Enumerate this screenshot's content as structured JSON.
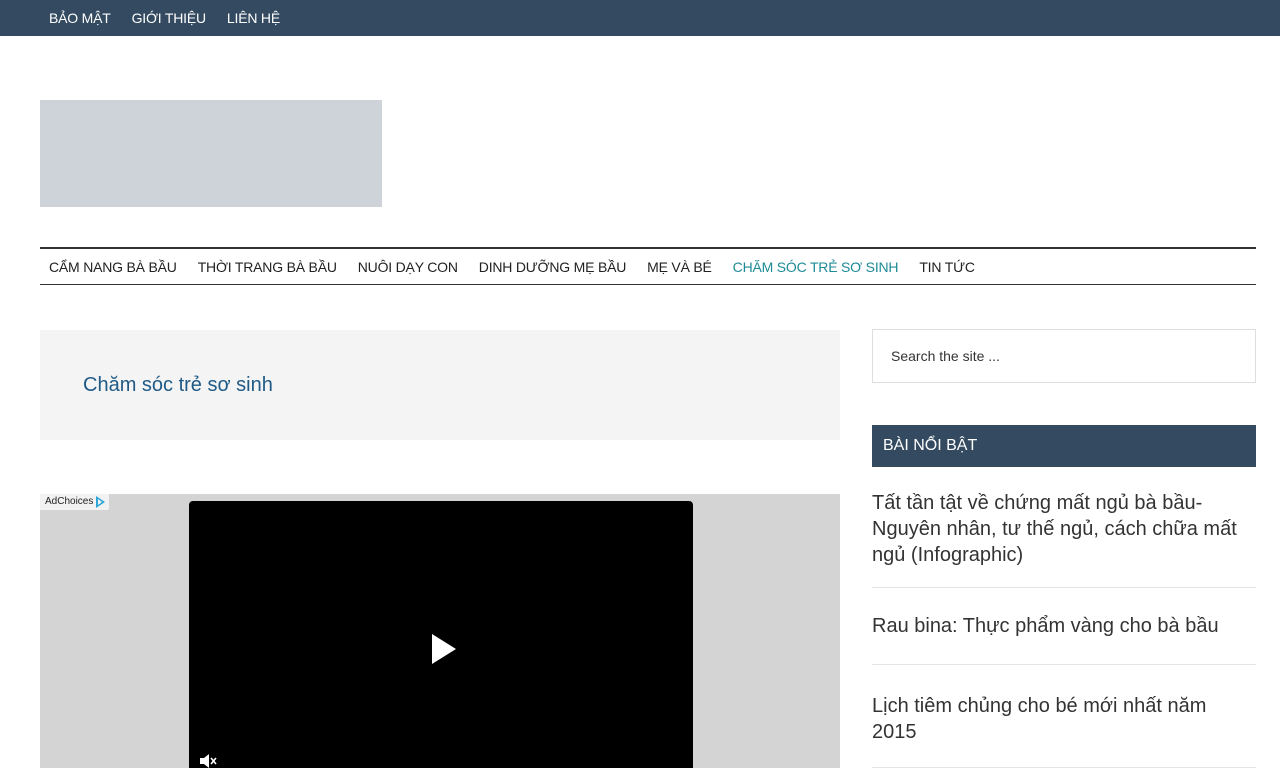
{
  "top_nav": {
    "items": [
      {
        "label": "BẢO MẬT"
      },
      {
        "label": "GIỚI THIỆU"
      },
      {
        "label": "LIÊN HỆ"
      }
    ]
  },
  "main_nav": {
    "items": [
      {
        "label": "CẨM NANG BÀ BẦU"
      },
      {
        "label": "THỜI TRANG BÀ BẦU"
      },
      {
        "label": "NUÔI DẠY CON"
      },
      {
        "label": "DINH DƯỠNG MẸ BẦU"
      },
      {
        "label": "MẸ VÀ BÉ"
      },
      {
        "label": "CHĂM SÓC TRẺ SƠ SINH",
        "active": true
      },
      {
        "label": "TIN TỨC"
      }
    ]
  },
  "archive": {
    "title": "Chăm sóc trẻ sơ sinh"
  },
  "ad": {
    "adchoices_label": "AdChoices",
    "play_icon": "play-icon",
    "mute_icon": "muted-speaker-icon"
  },
  "sidebar": {
    "search_placeholder": "Search the site ...",
    "featured_title": "BÀI NỔI BẬT",
    "posts": [
      {
        "title": "Tất tần tật về chứng mất ngủ bà bầu- Nguyên nhân, tư thế ngủ, cách chữa mất ngủ (Infographic)"
      },
      {
        "title": "Rau bina: Thực phẩm vàng cho bà bầu"
      },
      {
        "title": "Lịch tiêm chủng cho bé mới nhất năm 2015"
      }
    ]
  },
  "colors": {
    "header_bg": "#334a60",
    "accent": "#1f8b96",
    "archive_title": "#1f5a86"
  }
}
